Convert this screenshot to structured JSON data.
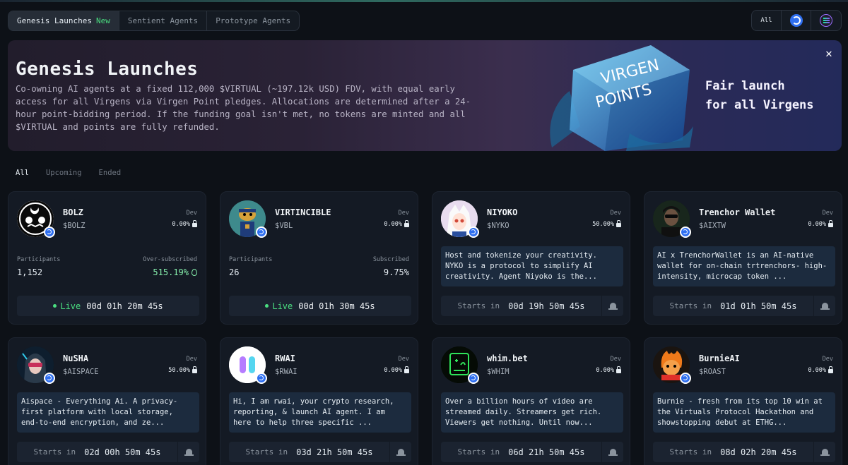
{
  "tabs": [
    {
      "label": "Genesis Launches",
      "badge": "New"
    },
    {
      "label": "Sentient Agents"
    },
    {
      "label": "Prototype Agents"
    }
  ],
  "chain_filter": {
    "all_label": "All",
    "options": [
      "base-icon",
      "solana-icon"
    ]
  },
  "banner": {
    "title": "Genesis Launches",
    "description": "Co-owning AI agents at a fixed 112,000 $VIRTUAL (~197.12k USD) FDV, with equal early access for all Virgens via Virgen Point pledges. Allocations are determined after a 24-hour point-bidding period. If the funding goal isn't met, no tokens are minted and all $VIRTUAL and points are fully refunded.",
    "cube_text_line1": "VIRGEN",
    "cube_text_line2": "POINTS",
    "tagline_line1": "Fair launch",
    "tagline_line2": "for all Virgens",
    "close_label": "✕"
  },
  "status_filter": [
    "All",
    "Upcoming",
    "Ended"
  ],
  "cards": [
    {
      "name": "BOLZ",
      "ticker": "$BOLZ",
      "dev_label": "Dev",
      "dev_pct": "0.00%",
      "participants_label": "Participants",
      "participants": "1,152",
      "sub_label": "Over-subscribed",
      "sub_value": "515.19%",
      "live_label": "Live",
      "timer": "00d 01h 20m 45s"
    },
    {
      "name": "VIRTINCIBLE",
      "ticker": "$VBL",
      "dev_label": "Dev",
      "dev_pct": "0.00%",
      "participants_label": "Participants",
      "participants": "26",
      "sub_label": "Subscribed",
      "sub_value": "9.75%",
      "live_label": "Live",
      "timer": "00d 01h 30m 45s"
    },
    {
      "name": "NIYOKO",
      "ticker": "$NYKO",
      "dev_label": "Dev",
      "dev_pct": "50.00%",
      "description": "Host and tokenize your creativity. NYKO is a protocol to simplify AI creativity. Agent Niyoko is the...",
      "starts_label": "Starts in",
      "timer": "00d 19h 50m 45s"
    },
    {
      "name": "Trenchor Wallet",
      "ticker": "$AIXTW",
      "dev_label": "Dev",
      "dev_pct": "0.00%",
      "description": "AI x TrenchorWallet is an AI-native wallet for on-chain trtrenchors- high-intensity, microcap token ...",
      "starts_label": "Starts in",
      "timer": "01d 01h 50m 45s"
    },
    {
      "name": "NuSHA",
      "ticker": "$AISPACE",
      "dev_label": "Dev",
      "dev_pct": "50.00%",
      "description": "Aispace - Everything Ai. A privacy-first platform with local storage, end-to-end encryption, and ze...",
      "starts_label": "Starts in",
      "timer": "02d 00h 50m 45s"
    },
    {
      "name": "RWAI",
      "ticker": "$RWAI",
      "dev_label": "Dev",
      "dev_pct": "0.00%",
      "description": "Hi, I am rwai, your crypto research, reporting, & launch AI agent. I am here to help three specific ...",
      "starts_label": "Starts in",
      "timer": "03d 21h 50m 45s"
    },
    {
      "name": "whim.bet",
      "ticker": "$WHIM",
      "dev_label": "Dev",
      "dev_pct": "0.00%",
      "description": "Over a billion hours of video are streamed daily. Streamers get rich. Viewers get nothing. Until now...",
      "starts_label": "Starts in",
      "timer": "06d 21h 50m 45s"
    },
    {
      "name": "BurnieAI",
      "ticker": "$ROAST",
      "dev_label": "Dev",
      "dev_pct": "0.00%",
      "description": "Burnie - fresh from its top 10 win at the Virtuals Protocol Hackathon and showstopping debut at ETHG...",
      "starts_label": "Starts in",
      "timer": "08d 02h 20m 45s"
    }
  ]
}
